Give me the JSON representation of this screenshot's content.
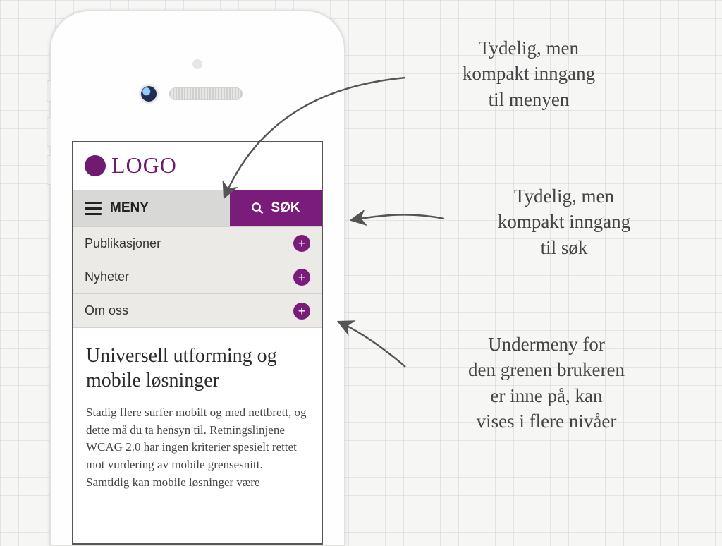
{
  "logo": {
    "text": "LOGO"
  },
  "toolbar": {
    "menu_label": "MENY",
    "search_label": "SØK"
  },
  "submenu": {
    "items": [
      {
        "label": "Publikasjoner"
      },
      {
        "label": "Nyheter"
      },
      {
        "label": "Om oss"
      }
    ]
  },
  "article": {
    "heading": "Universell utforming og mobile løsninger",
    "body": "Stadig flere surfer mobilt og med nettbrett, og dette må du ta hensyn til. Retningslinjene WCAG 2.0 har ingen kriterier spesielt rettet mot vurdering av mobile grensesnitt. Samtidig kan mobile løsninger være"
  },
  "annotations": {
    "a1": "Tydelig, men\nkompakt inngang\ntil menyen",
    "a2": "Tydelig, men\nkompakt inngang\ntil søk",
    "a3": "Undermeny for\nden grenen brukeren\ner inne på, kan\nvises i flere nivåer"
  },
  "colors": {
    "brand": "#7a1c7a",
    "menu_bg": "#d8d8d6",
    "submenu_bg": "#eceae7"
  }
}
